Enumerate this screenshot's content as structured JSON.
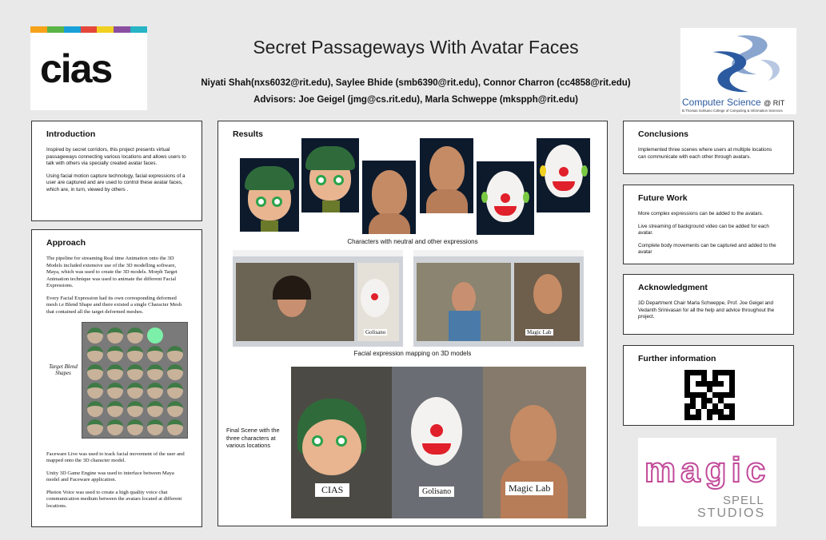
{
  "header": {
    "title": "Secret Passageways With Avatar Faces",
    "authors": "Niyati Shah(nxs6032@rit.edu), Saylee Bhide (smb6390@rit.edu), Connor Charron (cc4858@rit.edu)",
    "advisors": "Advisors:  Joe Geigel (jmg@cs.rit.edu),  Marla Schweppe (mkspph@rit.edu)"
  },
  "logos": {
    "cias": "cias",
    "cs_main": "Computer Science",
    "cs_suffix": "@ RIT",
    "cs_sub": "B.Thomas Golisano College of Computing & Information Sciences",
    "magic": "magic",
    "spell": "SPELL",
    "studios": "STUDIOS"
  },
  "introduction": {
    "heading": "Introduction",
    "p1": "Inspired by secret corridors, this project presents virtual passageways connecting various locations  and allows users to talk with others via specially created avatar faces.",
    "p2": "Using facial motion capture technology, facial expressions of a user are captured and are used to control these avatar faces, which are, in turn, viewed by others ."
  },
  "approach": {
    "heading": "Approach",
    "p1": "The pipeline for streaming Real time Animation onto the 3D Models included extensive use of the 3D modelling software, Maya, which was used to create the 3D models. Morph Target  Animation technique was used to animate the different Facial Expressions.",
    "p2": "Every Facial Expression had its own corresponding deformed mesh i.e Blend Shape and there existed a  single Character Mesh that contained all the target deformed meshes.",
    "blend_label": "Target Blend Shapes",
    "p3": "Faceware Live was used to track facial movement of the user and mapped onto the 3D character model.",
    "p4": "Unity 3D Game Engine was used to interface between Maya model and Faceware application.",
    "p5": "Photon Voice was used to create a high quality voice chat communication medium between the avatars located at different locations."
  },
  "results": {
    "heading": "Results",
    "caption1": "Characters with neutral and other expressions",
    "golisano_label": "Golisano",
    "magiclab_label": "Magic Lab",
    "caption2": "Facial expression mapping on 3D models",
    "final_text": "Final Scene  with the three characters at various locations",
    "scene_labels": [
      "CIAS",
      "Golisano",
      "Magic Lab"
    ]
  },
  "conclusions": {
    "heading": "Conclusions",
    "p1": "Implemented three scenes where users at multiple locations can communicate with each other through avatars."
  },
  "future_work": {
    "heading": "Future Work",
    "items": [
      "More complex expressions can be added to the avatars.",
      "Live streaming of background video can be added for each avatar.",
      "Complete body movements can be captured and added to the avatar"
    ]
  },
  "acknowledgment": {
    "heading": "Acknowledgment",
    "p1": "3D Department Chair Marla Schweppe, Prof. Joe Geigel and Vedanth Srinivasan  for all the help and advice throughout the project."
  },
  "further_info": {
    "heading": "Further information"
  },
  "colors": {
    "background": "#e9e9e9",
    "cs_blue": "#2c5aa0",
    "girl_hat": "#2f6b3a",
    "clown_white": "#f4f2f0"
  }
}
